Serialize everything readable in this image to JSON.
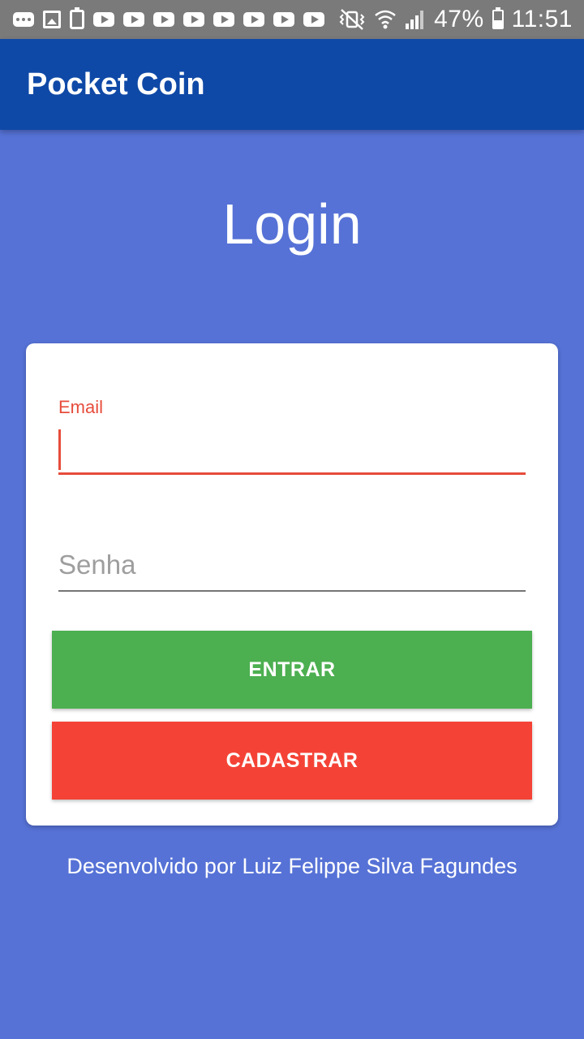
{
  "status_bar": {
    "left_icons": [
      "message-icon",
      "image-icon",
      "recycle-icon",
      "youtube-icon",
      "youtube-icon",
      "youtube-icon",
      "youtube-icon",
      "youtube-icon",
      "youtube-icon",
      "youtube-icon",
      "youtube-icon"
    ],
    "right_icons": [
      "vibrate-icon",
      "wifi-icon",
      "signal-icon",
      "battery-icon"
    ],
    "battery_percent": "47%",
    "time": "11:51",
    "background_color": "#7a7a7a"
  },
  "app_bar": {
    "title": "Pocket Coin",
    "color": "#0f49a7"
  },
  "page": {
    "heading": "Login",
    "background_color": "#5672d6"
  },
  "form": {
    "email_label": "Email",
    "email_value": "",
    "password_placeholder": "Senha",
    "password_value": "",
    "accent_color": "#e74c3c"
  },
  "buttons": {
    "login_label": "ENTRAR",
    "login_color": "#4caf50",
    "register_label": "CADASTRAR",
    "register_color": "#f44336"
  },
  "footer": {
    "credit": "Desenvolvido por Luiz Felippe Silva Fagundes"
  }
}
